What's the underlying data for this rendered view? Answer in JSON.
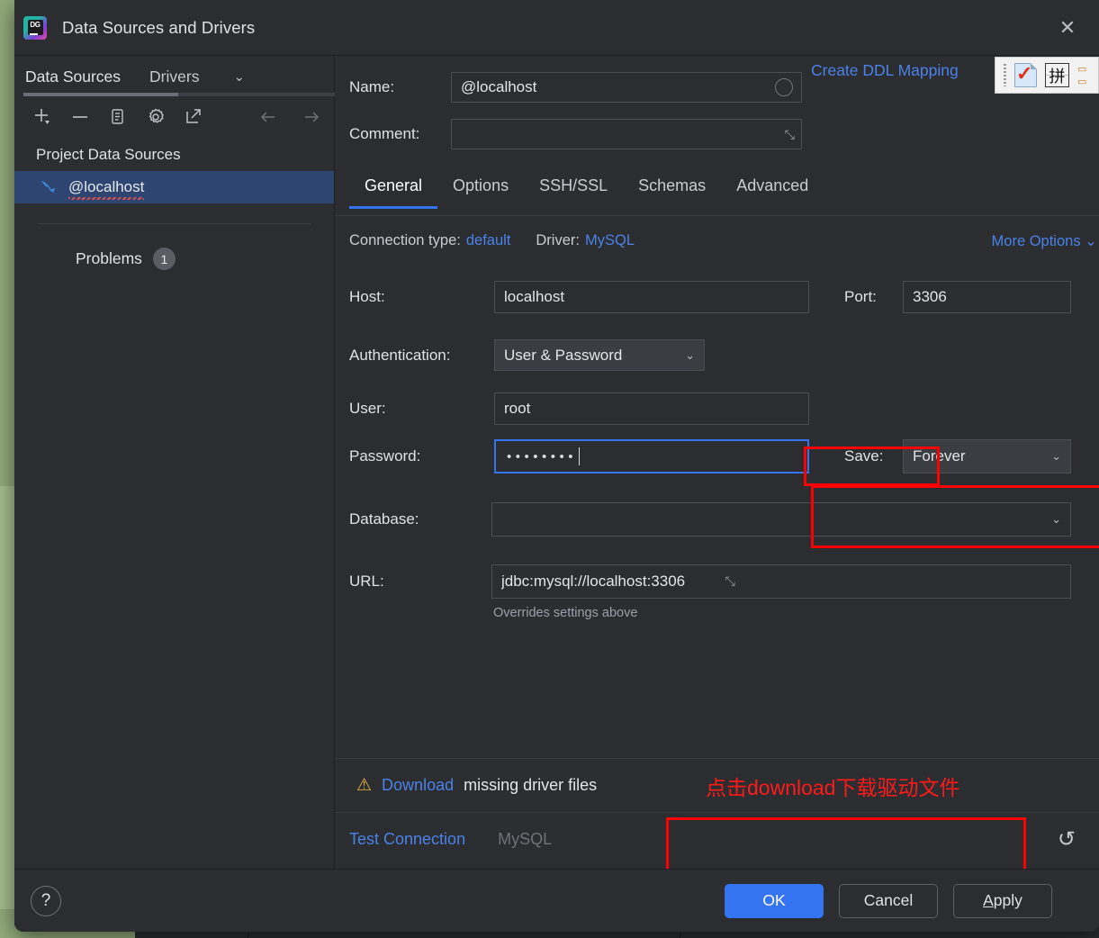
{
  "window": {
    "title": "Data Sources and Drivers",
    "app_icon": "datagrip-icon",
    "close_label": "✕"
  },
  "sidebar": {
    "tabs": [
      {
        "label": "Data Sources",
        "active": true
      },
      {
        "label": "Drivers",
        "active": false
      }
    ],
    "chevron": "⌄",
    "toolbar": [
      {
        "name": "add-icon",
        "glyph": "+"
      },
      {
        "name": "remove-icon",
        "glyph": "−"
      },
      {
        "name": "copy-icon",
        "glyph": "▤"
      },
      {
        "name": "settings-gear-icon",
        "glyph": "⚙"
      },
      {
        "name": "share-export-icon",
        "glyph": "↗"
      },
      {
        "name": "back-arrow-icon",
        "glyph": "←"
      },
      {
        "name": "forward-arrow-icon",
        "glyph": "→"
      }
    ],
    "section_title": "Project Data Sources",
    "items": [
      {
        "label": "@localhost",
        "icon": "mysql-dolphin-icon",
        "selected": true
      }
    ],
    "problems": {
      "label": "Problems",
      "count": "1"
    }
  },
  "form": {
    "name": {
      "label": "Name:",
      "value": "@localhost",
      "placeholder": ""
    },
    "ddl_mapping_link": "Create DDL Mapping",
    "comment": {
      "label": "Comment:",
      "value": "",
      "placeholder": ""
    },
    "tabs": [
      {
        "label": "General",
        "active": true
      },
      {
        "label": "Options",
        "active": false
      },
      {
        "label": "SSH/SSL",
        "active": false
      },
      {
        "label": "Schemas",
        "active": false
      },
      {
        "label": "Advanced",
        "active": false
      }
    ],
    "connection": {
      "type_label": "Connection type:",
      "type_value": "default",
      "driver_label": "Driver:",
      "driver_value": "MySQL",
      "more_options": "More Options",
      "more_options_chevron": "⌄"
    },
    "host": {
      "label": "Host:",
      "value": "localhost"
    },
    "port": {
      "label": "Port:",
      "value": "3306"
    },
    "authentication": {
      "label": "Authentication:",
      "value": "User & Password",
      "chevron": "⌄"
    },
    "user": {
      "label": "User:",
      "value": "root"
    },
    "password": {
      "label": "Password:",
      "value": "••••••••",
      "masked_length": 8
    },
    "save": {
      "label": "Save:",
      "value": "Forever",
      "chevron": "⌄"
    },
    "database": {
      "label": "Database:",
      "value": "",
      "chevron": "⌄"
    },
    "url": {
      "label": "URL:",
      "value": "jdbc:mysql://localhost:3306",
      "hint": "Overrides settings above"
    }
  },
  "warning": {
    "icon": "warning-triangle-icon",
    "link_text": "Download",
    "rest_text": "missing driver files",
    "annotation_cn": "点击download下载驱动文件",
    "annotation_color": "#ff0000"
  },
  "test_bar": {
    "test_connection": "Test Connection",
    "driver_name": "MySQL",
    "revert_icon": "↺"
  },
  "footer": {
    "help": "?",
    "ok": "OK",
    "cancel": "Cancel",
    "apply_mnemonic": "A",
    "apply_rest": "pply"
  },
  "ime_toolbar": {
    "icons": [
      "ime-document-check-icon",
      "pinyin-icon",
      "soft-keyboard-icon"
    ],
    "pinyin_glyph": "拼"
  },
  "colors": {
    "dialog_bg": "#2b2d30",
    "accent_blue": "#3574f0",
    "link_blue": "#4b82e8",
    "selection_blue": "#2f4571",
    "warning_yellow": "#e8b33a",
    "annotation_red": "#ff0000",
    "desktop_green": "#93ad7c"
  }
}
